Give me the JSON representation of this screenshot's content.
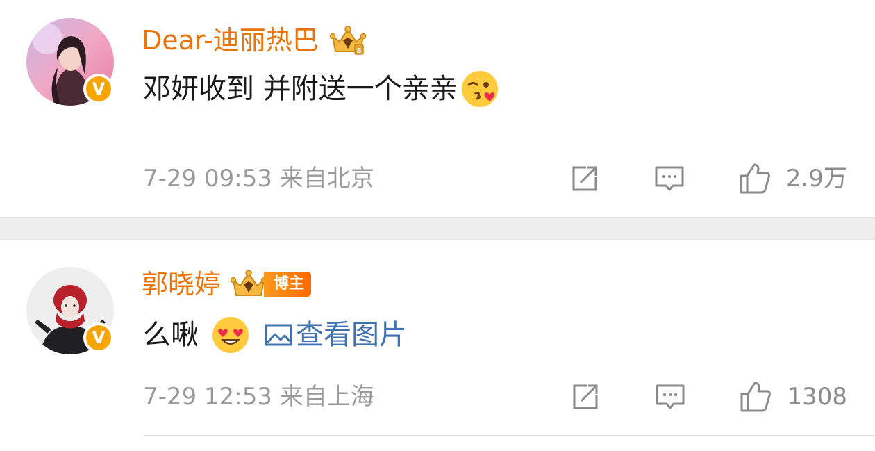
{
  "comments": [
    {
      "username": "Dear-迪丽热巴",
      "badge": "crown-vip-icon",
      "verified": "V",
      "text": "邓妍收到 并附送一个亲亲",
      "emoji": "kiss-wink-emoji",
      "time_location": "7-29 09:53 来自北京",
      "likes": "2.9万"
    },
    {
      "username": "郭晓婷",
      "badge": "crown-blogger-icon",
      "badge_label": "博主",
      "verified": "V",
      "text": "么啾",
      "emoji": "heart-eyes-emoji",
      "view_image_label": "查看图片",
      "time_location": "7-29 12:53 来自上海",
      "likes": "1308"
    }
  ],
  "colors": {
    "username": "#e8750a",
    "link": "#3f72af",
    "meta": "#9a9a9a",
    "verified_badge": "#f7a500",
    "separator": "#eeeeee"
  }
}
